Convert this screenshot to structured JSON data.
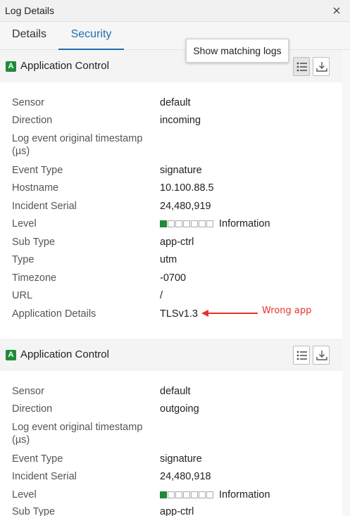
{
  "window": {
    "title": "Log Details"
  },
  "tabs": [
    {
      "label": "Details",
      "active": false
    },
    {
      "label": "Security",
      "active": true
    }
  ],
  "tooltip": {
    "text": "Show matching logs"
  },
  "sections": [
    {
      "badge": "A",
      "title": "Application Control",
      "rows": [
        {
          "label": "Sensor",
          "value": "default"
        },
        {
          "label": "Direction",
          "value": "incoming"
        },
        {
          "label": "Log event original timestamp (µs)",
          "value": ""
        },
        {
          "label": "Event Type",
          "value": "signature"
        },
        {
          "label": "Hostname",
          "value": "10.100.88.5"
        },
        {
          "label": "Incident Serial",
          "value": "24,480,919"
        },
        {
          "label": "Level",
          "value": "Information",
          "level_filled": 1,
          "level_total": 7
        },
        {
          "label": "Sub Type",
          "value": "app-ctrl"
        },
        {
          "label": "Type",
          "value": "utm"
        },
        {
          "label": "Timezone",
          "value": "-0700"
        },
        {
          "label": "URL",
          "value": "/"
        },
        {
          "label": "Application Details",
          "value": "TLSv1.3"
        }
      ]
    },
    {
      "badge": "A",
      "title": "Application Control",
      "rows": [
        {
          "label": "Sensor",
          "value": "default"
        },
        {
          "label": "Direction",
          "value": "outgoing"
        },
        {
          "label": "Log event original timestamp (µs)",
          "value": ""
        },
        {
          "label": "Event Type",
          "value": "signature"
        },
        {
          "label": "Incident Serial",
          "value": "24,480,918"
        },
        {
          "label": "Level",
          "value": "Information",
          "level_filled": 1,
          "level_total": 7
        },
        {
          "label": "Sub Type",
          "value": "app-ctrl"
        }
      ]
    }
  ],
  "annotation": {
    "text": "Wrong app",
    "color": "#e8322b"
  },
  "colors": {
    "accent": "#1f6fb0",
    "badge_green": "#1f8a3a"
  }
}
